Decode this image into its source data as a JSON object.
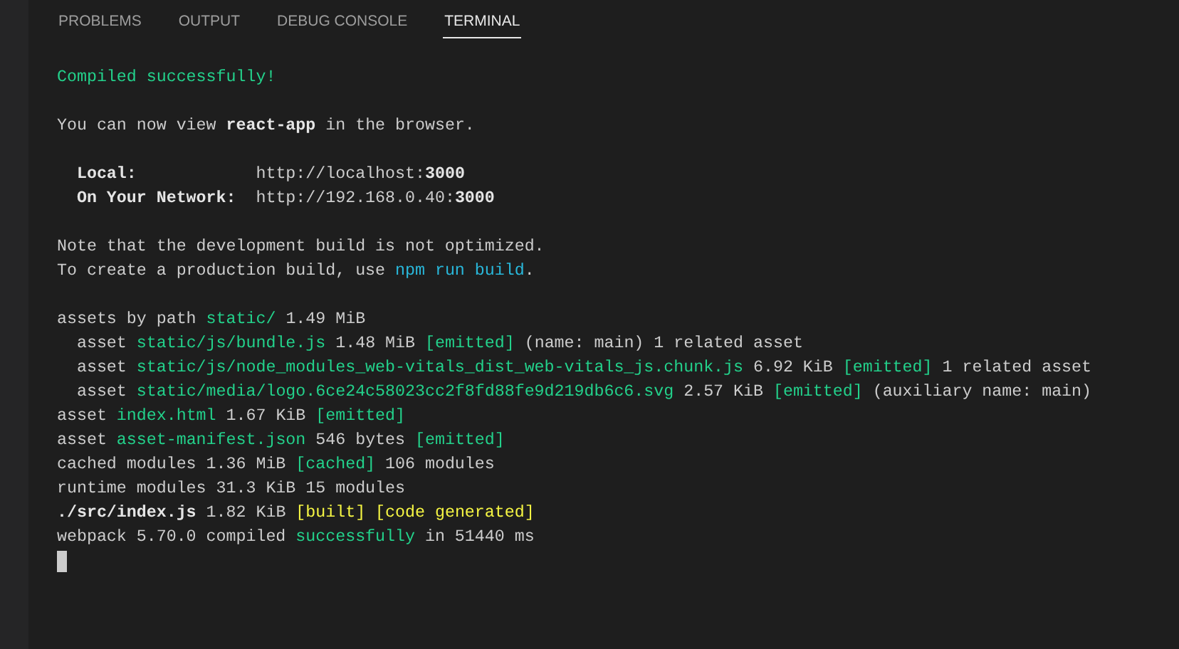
{
  "tabs": [
    {
      "label": "PROBLEMS",
      "selected": false
    },
    {
      "label": "OUTPUT",
      "selected": false
    },
    {
      "label": "DEBUG CONSOLE",
      "selected": false
    },
    {
      "label": "TERMINAL",
      "selected": true
    }
  ],
  "terminal": {
    "lines": [
      {
        "kind": "text",
        "segments": [
          {
            "text": "Compiled successfully!",
            "kind": "green"
          }
        ]
      },
      {
        "kind": "blank"
      },
      {
        "kind": "text",
        "segments": [
          {
            "text": "You can now view ",
            "kind": "plain"
          },
          {
            "text": "react-app",
            "kind": "bold"
          },
          {
            "text": " in the browser.",
            "kind": "plain"
          }
        ]
      },
      {
        "kind": "blank"
      },
      {
        "kind": "text",
        "segments": [
          {
            "text": "  Local:",
            "kind": "bold"
          },
          {
            "text": "            http://localhost:",
            "kind": "plain"
          },
          {
            "text": "3000",
            "kind": "bold"
          }
        ]
      },
      {
        "kind": "text",
        "segments": [
          {
            "text": "  On Your Network:",
            "kind": "bold"
          },
          {
            "text": "  http://192.168.0.40:",
            "kind": "plain"
          },
          {
            "text": "3000",
            "kind": "bold"
          }
        ]
      },
      {
        "kind": "blank"
      },
      {
        "kind": "text",
        "segments": [
          {
            "text": "Note that the development build is not optimized.",
            "kind": "plain"
          }
        ]
      },
      {
        "kind": "text",
        "segments": [
          {
            "text": "To create a production build, use ",
            "kind": "plain"
          },
          {
            "text": "npm run build",
            "kind": "blue"
          },
          {
            "text": ".",
            "kind": "plain"
          }
        ]
      },
      {
        "kind": "blank"
      },
      {
        "kind": "text",
        "segments": [
          {
            "text": "assets by path ",
            "kind": "plain"
          },
          {
            "text": "static/",
            "kind": "green"
          },
          {
            "text": " 1.49 MiB",
            "kind": "plain"
          }
        ]
      },
      {
        "kind": "text",
        "segments": [
          {
            "text": "  asset ",
            "kind": "plain"
          },
          {
            "text": "static/js/bundle.js",
            "kind": "green"
          },
          {
            "text": " 1.48 MiB ",
            "kind": "plain"
          },
          {
            "text": "[emitted]",
            "kind": "green"
          },
          {
            "text": " (name: main) 1 related asset",
            "kind": "plain"
          }
        ]
      },
      {
        "kind": "text",
        "segments": [
          {
            "text": "  asset ",
            "kind": "plain"
          },
          {
            "text": "static/js/node_modules_web-vitals_dist_web-vitals_js.chunk.js",
            "kind": "green"
          },
          {
            "text": " 6.92 KiB ",
            "kind": "plain"
          },
          {
            "text": "[emitted]",
            "kind": "green"
          },
          {
            "text": " 1 related asset",
            "kind": "plain"
          }
        ]
      },
      {
        "kind": "text",
        "segments": [
          {
            "text": "  asset ",
            "kind": "plain"
          },
          {
            "text": "static/media/logo.6ce24c58023cc2f8fd88fe9d219db6c6.svg",
            "kind": "green"
          },
          {
            "text": " 2.57 KiB ",
            "kind": "plain"
          },
          {
            "text": "[emitted]",
            "kind": "green"
          },
          {
            "text": " (auxiliary name: main)",
            "kind": "plain"
          }
        ]
      },
      {
        "kind": "text",
        "segments": [
          {
            "text": "asset ",
            "kind": "plain"
          },
          {
            "text": "index.html",
            "kind": "green"
          },
          {
            "text": " 1.67 KiB ",
            "kind": "plain"
          },
          {
            "text": "[emitted]",
            "kind": "green"
          }
        ]
      },
      {
        "kind": "text",
        "segments": [
          {
            "text": "asset ",
            "kind": "plain"
          },
          {
            "text": "asset-manifest.json",
            "kind": "green"
          },
          {
            "text": " 546 bytes ",
            "kind": "plain"
          },
          {
            "text": "[emitted]",
            "kind": "green"
          }
        ]
      },
      {
        "kind": "text",
        "segments": [
          {
            "text": "cached modules 1.36 MiB ",
            "kind": "plain"
          },
          {
            "text": "[cached]",
            "kind": "green"
          },
          {
            "text": " 106 modules",
            "kind": "plain"
          }
        ]
      },
      {
        "kind": "text",
        "segments": [
          {
            "text": "runtime modules 31.3 KiB 15 modules",
            "kind": "plain"
          }
        ]
      },
      {
        "kind": "text",
        "segments": [
          {
            "text": "./src/index.js",
            "kind": "bold"
          },
          {
            "text": " 1.82 KiB ",
            "kind": "plain"
          },
          {
            "text": "[built] [code generated]",
            "kind": "yellow"
          }
        ]
      },
      {
        "kind": "text",
        "segments": [
          {
            "text": "webpack 5.70.0 compiled ",
            "kind": "plain"
          },
          {
            "text": "successfully",
            "kind": "green"
          },
          {
            "text": " in 51440 ms",
            "kind": "plain"
          }
        ]
      }
    ],
    "cursor": true
  }
}
